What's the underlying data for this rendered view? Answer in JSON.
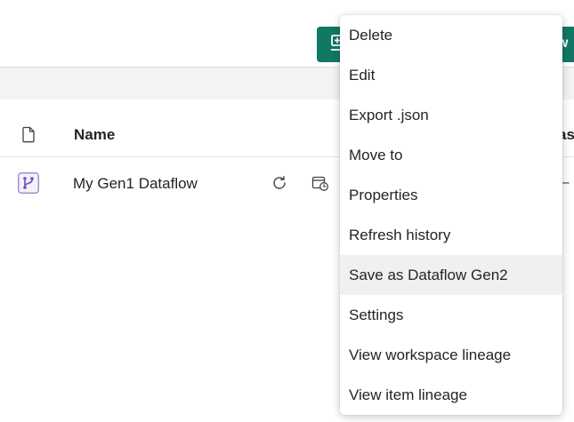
{
  "toolbar": {
    "new_button_label": "w"
  },
  "table": {
    "columns": {
      "name": "Name",
      "extra": "as"
    },
    "rows": [
      {
        "name": "My Gen1 Dataflow",
        "trailing": "–"
      }
    ]
  },
  "context_menu": {
    "items": [
      {
        "label": "Delete"
      },
      {
        "label": "Edit"
      },
      {
        "label": "Export .json"
      },
      {
        "label": "Move to"
      },
      {
        "label": "Properties"
      },
      {
        "label": "Refresh history"
      },
      {
        "label": "Save as Dataflow Gen2",
        "hovered": true
      },
      {
        "label": "Settings"
      },
      {
        "label": "View workspace lineage"
      },
      {
        "label": "View item lineage"
      }
    ]
  },
  "colors": {
    "accent": "#117865",
    "dataflow_icon": "#6b4fb8",
    "hover_bg": "#f0f0f0"
  },
  "icons": {
    "toolbar_button": "new-item-icon",
    "header_column": "document-icon",
    "row_item": "dataflow-icon",
    "row_action_1": "refresh-icon",
    "row_action_2": "schedule-refresh-icon"
  }
}
